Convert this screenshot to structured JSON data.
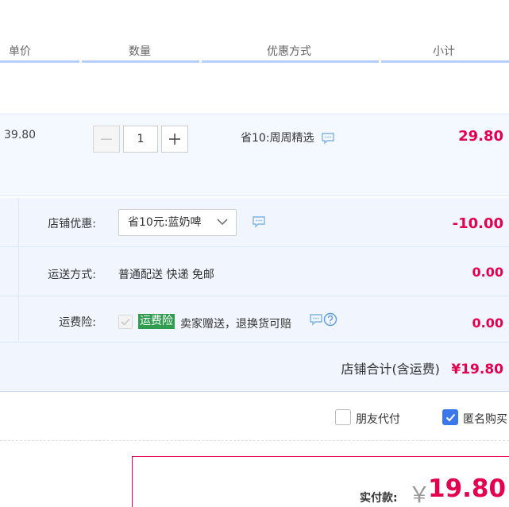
{
  "columns": {
    "unit_price": "单价",
    "quantity": "数量",
    "discount": "优惠方式",
    "subtotal": "小计"
  },
  "item": {
    "unit_price": "39.80",
    "quantity": "1",
    "promo": "省10:周周精选",
    "subtotal": "29.80"
  },
  "store_discount": {
    "label": "店铺优惠:",
    "selected": "省10元:蓝奶啤",
    "value": "-10.00"
  },
  "shipping": {
    "label": "运送方式:",
    "method": "普通配送 快递 免邮",
    "value": "0.00"
  },
  "insurance": {
    "label": "运费险:",
    "badge": "运费险",
    "text": "卖家赠送，退换货可赔",
    "value": "0.00"
  },
  "store_total": {
    "label": "店铺合计(含运费)",
    "value": "¥19.80"
  },
  "options": {
    "friend_pay": "朋友代付",
    "anonymous": "匿名购买"
  },
  "payment": {
    "label": "实付款:",
    "currency": "￥",
    "amount": "19.80"
  },
  "colors": {
    "accent_red": "#e5004f",
    "insurance_green": "#2f9c4f",
    "checkbox_blue": "#3a77ea"
  }
}
